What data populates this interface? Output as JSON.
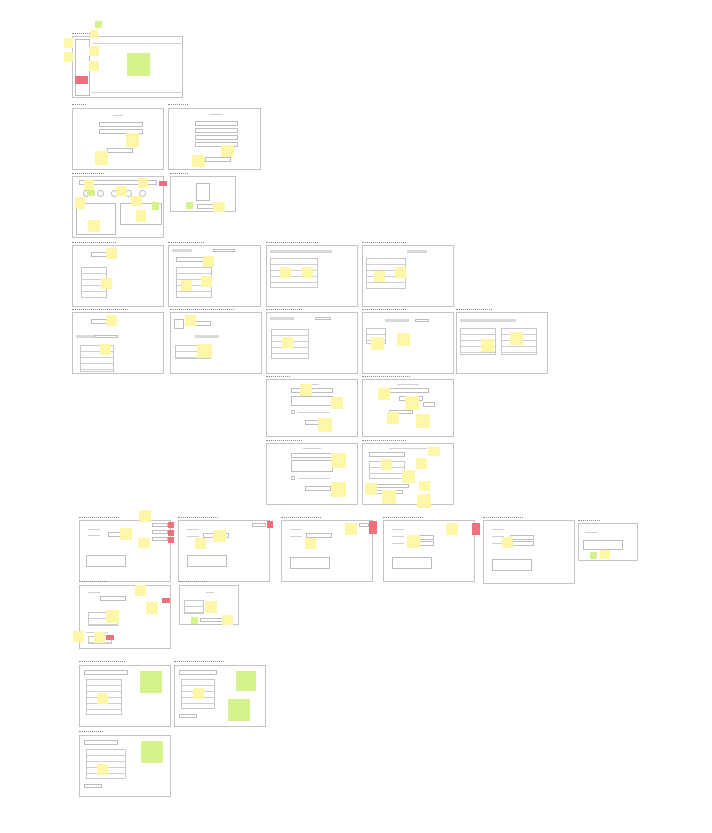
{
  "board": {
    "background": "#ffffff",
    "frame_border": "#c4c4c4",
    "sticky_yellow": "#fff7a8",
    "sticky_green": "#d6f28a",
    "sticky_red": "#ef6f7d"
  }
}
